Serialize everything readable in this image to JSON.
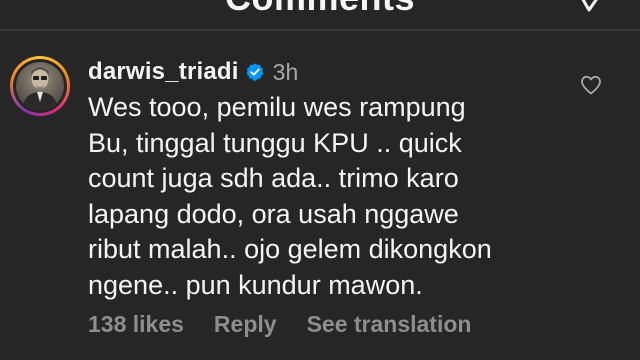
{
  "header": {
    "title": "Comments"
  },
  "comment": {
    "username": "darwis_triadi",
    "timestamp": "3h",
    "lines": [
      "Wes tooo, pemilu wes rampung",
      "Bu, tinggal tunggu KPU .. quick",
      "count juga sdh ada.. trimo karo",
      "lapang dodo, ora usah nggawe",
      "ribut malah.. ojo gelem dikongkon",
      "ngene.. pun kundur mawon."
    ],
    "likes_label": "138 likes",
    "reply_label": "Reply",
    "translation_label": "See translation"
  },
  "colors": {
    "background": "#262626",
    "text_primary": "#f5f5f5",
    "text_secondary": "#a8a8a8",
    "action_text": "#8e8e8e",
    "verified_badge": "#0095f6"
  },
  "icons": {
    "header_action": "checkmark-icon",
    "verified": "verified-badge-icon",
    "like": "heart-outline-icon"
  }
}
